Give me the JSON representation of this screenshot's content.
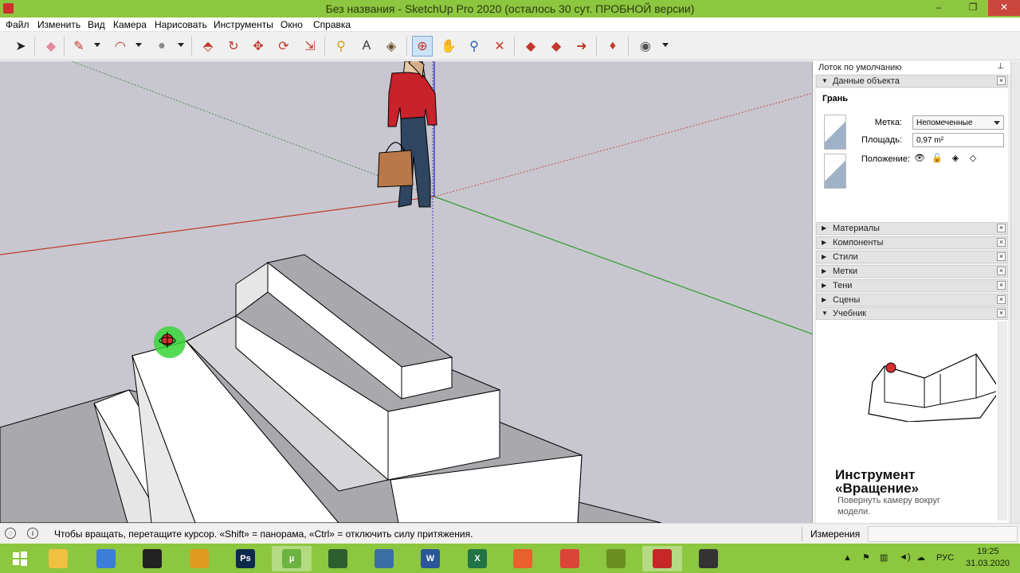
{
  "window": {
    "title": "Без названия - SketchUp Pro 2020 (осталось 30 сут. ПРОБНОЙ версии)",
    "minimize": "–",
    "maximize": "❐",
    "close": "✕"
  },
  "menu": [
    "Файл",
    "Изменить",
    "Вид",
    "Камера",
    "Нарисовать",
    "Инструменты",
    "Окно",
    "Справка"
  ],
  "toolbar": {
    "tools": [
      {
        "name": "select-tool-icon",
        "glyph": "➤",
        "color": "#222222"
      },
      {
        "name": "eraser-tool-icon",
        "glyph": "◆",
        "color": "#e58aa0"
      },
      {
        "name": "pencil-tool-icon",
        "glyph": "✎",
        "color": "#c0392b"
      },
      {
        "name": "arc-tool-icon",
        "glyph": "◠",
        "color": "#c0392b"
      },
      {
        "name": "shape-tool-icon",
        "glyph": "●",
        "color": "#8a8a8a"
      },
      {
        "name": "push-pull-tool-icon",
        "glyph": "⬘",
        "color": "#c0392b"
      },
      {
        "name": "offset-tool-icon",
        "glyph": "↻",
        "color": "#c0392b"
      },
      {
        "name": "move-tool-icon",
        "glyph": "✥",
        "color": "#c0392b"
      },
      {
        "name": "rotate-tool-icon",
        "glyph": "⟳",
        "color": "#c0392b"
      },
      {
        "name": "scale-tool-icon",
        "glyph": "⇲",
        "color": "#c0392b"
      },
      {
        "name": "tape-measure-tool-icon",
        "glyph": "⚲",
        "color": "#d4a017"
      },
      {
        "name": "text-tool-icon",
        "glyph": "A",
        "color": "#333333"
      },
      {
        "name": "paint-bucket-tool-icon",
        "glyph": "◈",
        "color": "#6b4f2a"
      },
      {
        "name": "orbit-tool-icon",
        "glyph": "⊕",
        "color": "#c0392b"
      },
      {
        "name": "pan-tool-icon",
        "glyph": "✋",
        "color": "#d9b26a"
      },
      {
        "name": "zoom-tool-icon",
        "glyph": "⚲",
        "color": "#2a5db0"
      },
      {
        "name": "zoom-extents-tool-icon",
        "glyph": "✕",
        "color": "#c0392b"
      },
      {
        "name": "3d-warehouse-icon",
        "glyph": "◆",
        "color": "#c0392b"
      },
      {
        "name": "extension-warehouse-icon",
        "glyph": "◆",
        "color": "#c0392b"
      },
      {
        "name": "layout-send-icon",
        "glyph": "➜",
        "color": "#c0392b"
      },
      {
        "name": "ruby-console-icon",
        "glyph": "♦",
        "color": "#c0392b"
      },
      {
        "name": "account-icon",
        "glyph": "◉",
        "color": "#555555"
      }
    ]
  },
  "tray": {
    "title": "Лоток по умолчанию",
    "pin": "⊥",
    "entity_info": {
      "header": "Данные объекта",
      "entity_type": "Грань",
      "tag_label": "Метка:",
      "tag_value": "Непомеченные",
      "area_label": "Площадь:",
      "area_value": "0,97 m²",
      "position_label": "Положение:"
    },
    "panels": [
      "Материалы",
      "Компоненты",
      "Стили",
      "Метки",
      "Тени",
      "Сцены"
    ],
    "instructor": {
      "header": "Учебник",
      "title_line1": "Инструмент",
      "title_line2": "«Вращение»",
      "description": "Повернуть камеру вокруг модели."
    }
  },
  "status": {
    "message": "Чтобы вращать, перетащите курсор. «Shift» = панорама, «Ctrl» = отключить силу притяжения.",
    "measurements_label": "Измерения",
    "measurements_value": ""
  },
  "taskbar": {
    "apps": [
      {
        "name": "start-button",
        "label": "",
        "color": "#8dc63f"
      },
      {
        "name": "file-explorer-icon",
        "label": "",
        "color": "#f0c040"
      },
      {
        "name": "control-panel-icon",
        "label": "",
        "color": "#3b7dd8"
      },
      {
        "name": "video-app-icon",
        "label": "",
        "color": "#222222"
      },
      {
        "name": "archicad-icon",
        "label": "",
        "color": "#e09a1f"
      },
      {
        "name": "photoshop-icon",
        "label": "Ps",
        "color": "#0d2a4a"
      },
      {
        "name": "utorrent-icon",
        "label": "µ",
        "color": "#6db33f"
      },
      {
        "name": "gps-app-icon",
        "label": "",
        "color": "#2e5e2e"
      },
      {
        "name": "python-icon",
        "label": "",
        "color": "#3a6ea5"
      },
      {
        "name": "word-icon",
        "label": "W",
        "color": "#2b579a"
      },
      {
        "name": "excel-icon",
        "label": "X",
        "color": "#217346"
      },
      {
        "name": "firefox-icon",
        "label": "",
        "color": "#e8612c"
      },
      {
        "name": "chrome-icon",
        "label": "",
        "color": "#db4437"
      },
      {
        "name": "minecraft-icon",
        "label": "",
        "color": "#6b8e23"
      },
      {
        "name": "sketchup-icon",
        "label": "",
        "color": "#c62828"
      },
      {
        "name": "media-player-icon",
        "label": "",
        "color": "#333333"
      }
    ],
    "language": "РУС",
    "time": "19:25",
    "date": "31.03.2020"
  }
}
